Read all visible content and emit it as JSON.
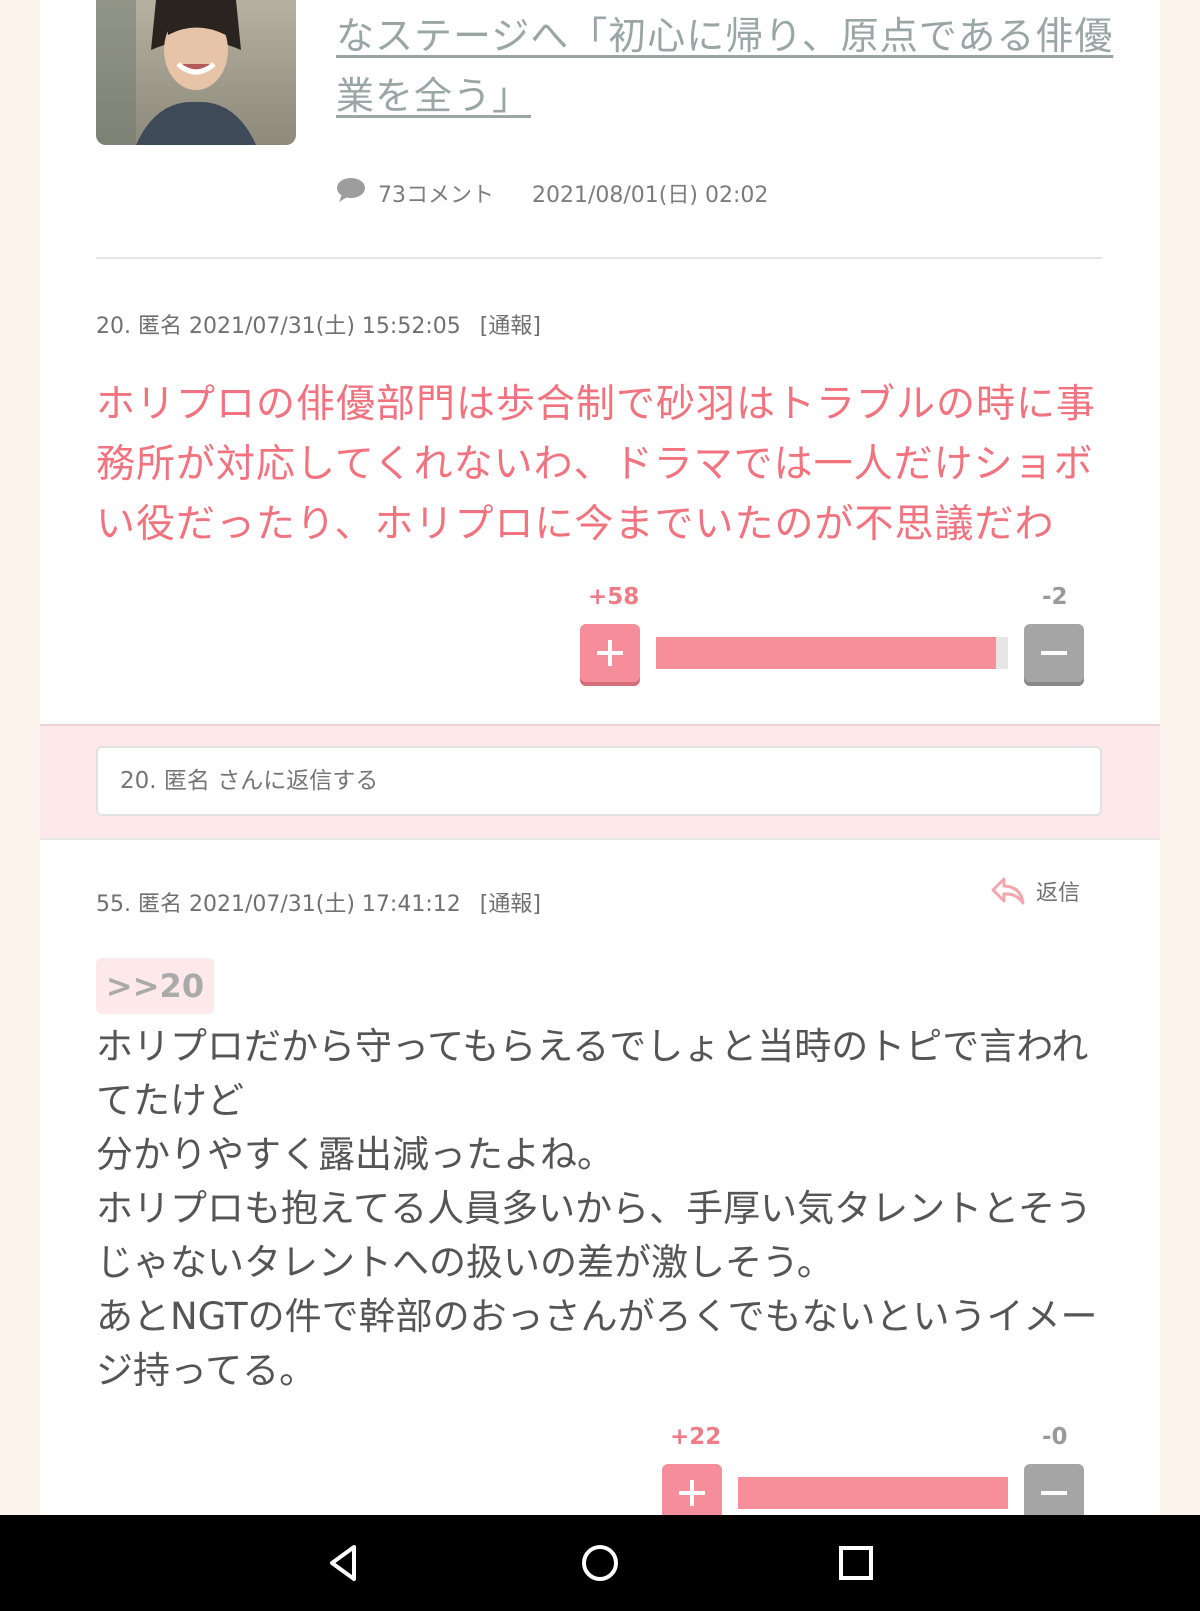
{
  "article": {
    "title": "なステージへ「初心に帰り、原点である俳優業を全う」",
    "comment_count": "73コメント",
    "date": "2021/08/01(日) 02:02"
  },
  "comment_20": {
    "header": "20. 匿名 2021/07/31(土) 15:52:05",
    "report": "[通報]",
    "body": "ホリプロの俳優部門は歩合制で砂羽はトラブルの時に事務所が対応してくれないわ、ドラマでは一人だけショボい役だったり、ホリプロに今までいたのが不思議だわ",
    "plus_score": "+58",
    "minus_score": "-2",
    "positive_ratio": 0.967
  },
  "reply_box": {
    "placeholder": "20. 匿名 さんに返信する"
  },
  "comment_55": {
    "header": "55. 匿名 2021/07/31(土) 17:41:12",
    "report": "[通報]",
    "reply_label": "返信",
    "anchor": ">>20",
    "lines": [
      "ホリプロだから守ってもらえるでしょと当時のトピで言われてたけど",
      "分かりやすく露出減ったよね。",
      "ホリプロも抱えてる人員多いから、手厚い気タレントとそうじゃないタレントへの扱いの差が激しそう。",
      "あとNGTの件で幹部のおっさんがろくでもないというイメージ持ってる。"
    ],
    "plus_score": "+22",
    "minus_score": "-0",
    "positive_ratio": 1.0
  },
  "icons": {
    "comment": "speech-bubble-icon",
    "reply": "reply-arrow-icon",
    "plus": "plus-icon",
    "minus": "minus-icon"
  },
  "colors": {
    "accent_pink": "#f58e9a",
    "comment_text_red": "#f0737f",
    "link_gray": "#9aa6a6"
  }
}
